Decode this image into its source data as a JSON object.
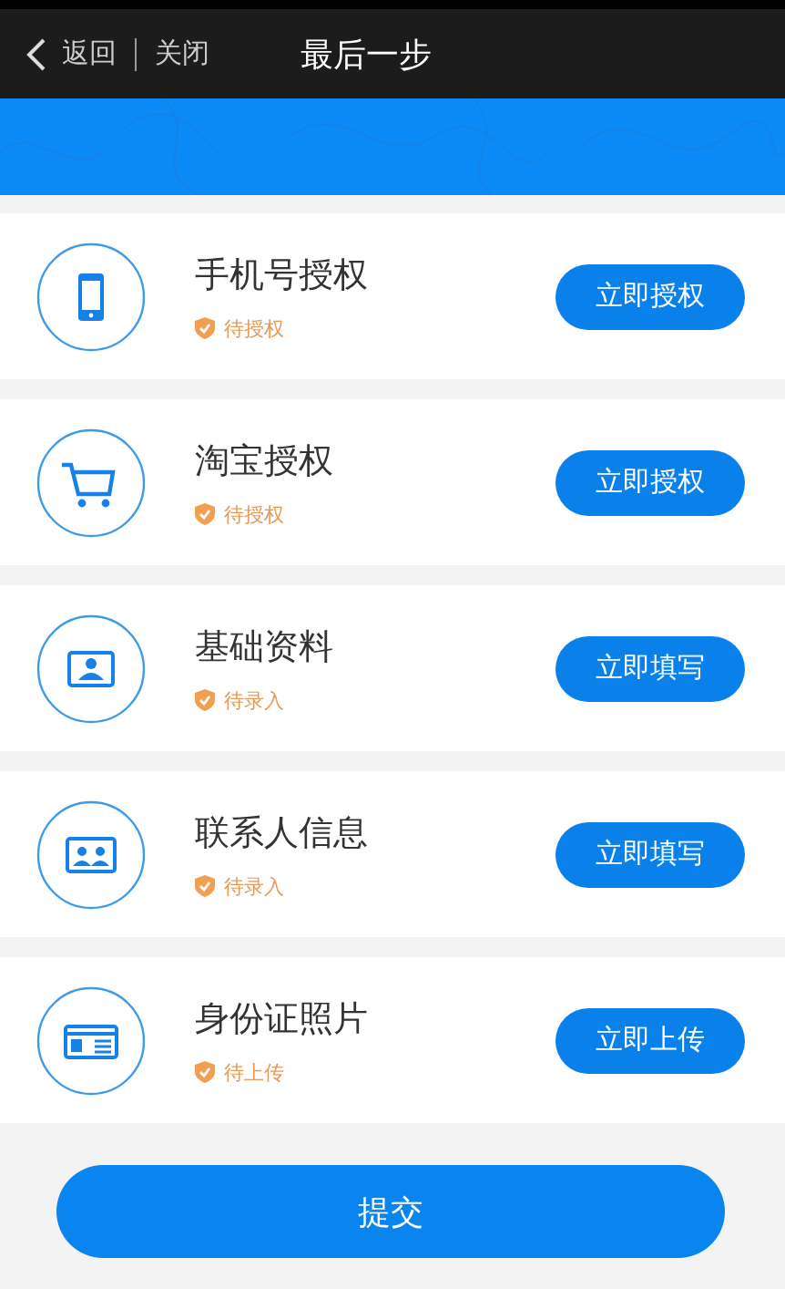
{
  "header": {
    "back_label": "返回",
    "close_label": "关闭",
    "title": "最后一步"
  },
  "items": [
    {
      "kind": "phone",
      "title": "手机号授权",
      "status": "待授权",
      "action": "立即授权"
    },
    {
      "kind": "cart",
      "title": "淘宝授权",
      "status": "待授权",
      "action": "立即授权"
    },
    {
      "kind": "profile",
      "title": "基础资料",
      "status": "待录入",
      "action": "立即填写"
    },
    {
      "kind": "contacts",
      "title": "联系人信息",
      "status": "待录入",
      "action": "立即填写"
    },
    {
      "kind": "idcard",
      "title": "身份证照片",
      "status": "待上传",
      "action": "立即上传"
    }
  ],
  "submit_label": "提交"
}
